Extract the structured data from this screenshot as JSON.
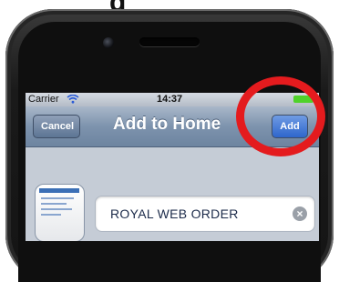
{
  "header_text": "g",
  "status_bar": {
    "carrier": "Carrier",
    "time": "14:37"
  },
  "nav_bar": {
    "cancel_label": "Cancel",
    "title": "Add to Home",
    "add_label": "Add"
  },
  "bookmark": {
    "name_value": "ROYAL WEB ORDER"
  },
  "colors": {
    "highlight_circle": "#e41b1e",
    "add_button": "#2e66cc",
    "battery": "#4fd22a"
  },
  "icons": [
    "wifi-icon",
    "battery-icon",
    "clear-icon",
    "app-icon"
  ]
}
